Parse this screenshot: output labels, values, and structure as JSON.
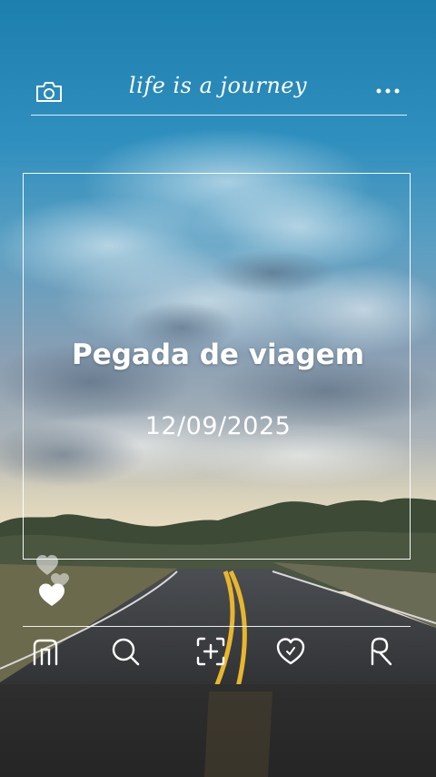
{
  "header": {
    "title": "life is a journey",
    "camera_icon": "camera-icon",
    "more_icon": "more-dots-icon"
  },
  "card": {
    "heading": "Pegada de viagem",
    "date": "12/09/2025"
  },
  "reactions": {
    "icon": "hearts-icon"
  },
  "nav": {
    "items": [
      {
        "icon": "home-icon"
      },
      {
        "icon": "search-icon"
      },
      {
        "icon": "add-post-icon"
      },
      {
        "icon": "heart-icon"
      },
      {
        "icon": "profile-icon"
      }
    ]
  },
  "colors": {
    "sky_top": "#1d7fae",
    "sky_mid": "#8fb6c9",
    "horizon": "#e6dcc0",
    "road": "#3d4043",
    "lane_line": "#e8b62e"
  }
}
